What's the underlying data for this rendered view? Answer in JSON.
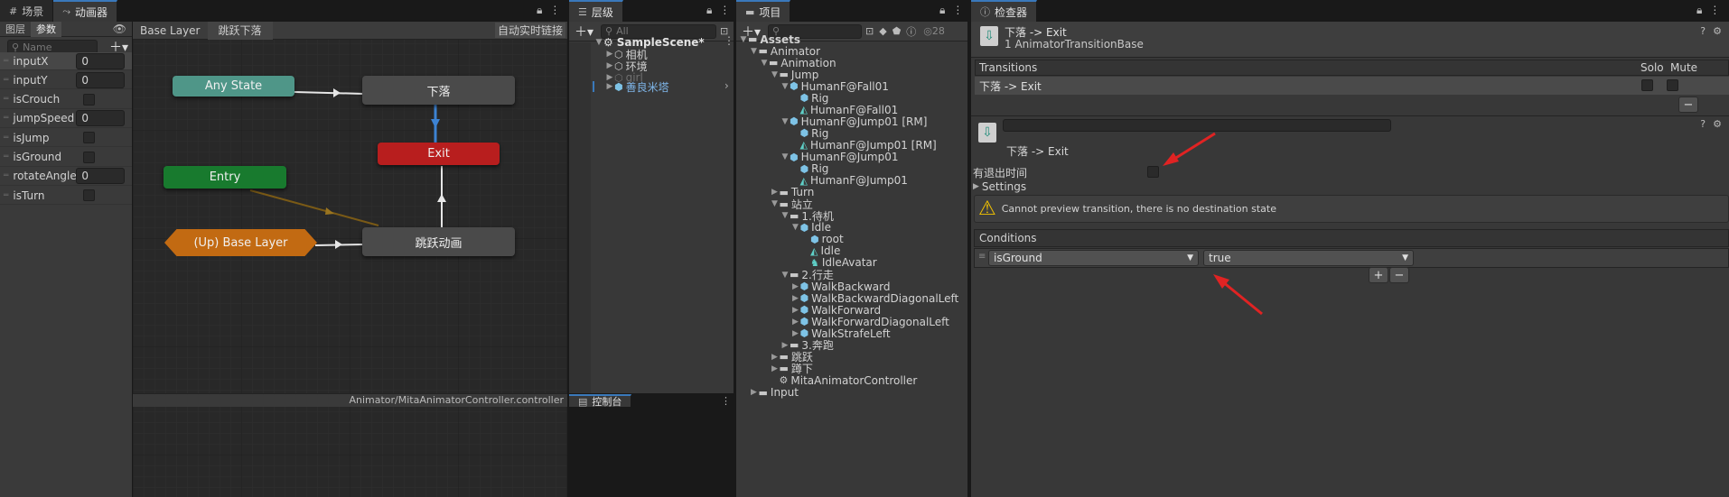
{
  "tabs": {
    "scene": "场景",
    "animator": "动画器",
    "hierarchy": "层级",
    "project": "项目",
    "inspector": "检查器",
    "console": "控制台"
  },
  "animator": {
    "layers_tab": "图层",
    "params_tab": "参数",
    "search_placeholder": "Name",
    "breadcrumb": [
      "Base Layer",
      "跳跃下落"
    ],
    "auto_live_link": "自动实时链接",
    "params": [
      {
        "name": "inputX",
        "type": "float",
        "value": "0"
      },
      {
        "name": "inputY",
        "type": "float",
        "value": "0"
      },
      {
        "name": "isCrouch",
        "type": "bool",
        "value": ""
      },
      {
        "name": "jumpSpeed",
        "type": "float",
        "value": "0"
      },
      {
        "name": "isJump",
        "type": "bool",
        "value": ""
      },
      {
        "name": "isGround",
        "type": "bool",
        "value": ""
      },
      {
        "name": "rotateAngle",
        "type": "float",
        "value": "0"
      },
      {
        "name": "isTurn",
        "type": "bool",
        "value": ""
      }
    ],
    "nodes": {
      "any_state": "Any State",
      "fall": "下落",
      "exit": "Exit",
      "entry": "Entry",
      "up_base": "(Up) Base Layer",
      "jump_anim": "跳跃动画"
    },
    "footer_path": "Animator/MitaAnimatorController.controller"
  },
  "hierarchy": {
    "search_placeholder": "All",
    "scene": "SampleScene*",
    "items": [
      "相机",
      "环境",
      "girl",
      "善良米塔"
    ]
  },
  "project": {
    "count": "28",
    "tree": [
      {
        "label": "Assets",
        "depth": 0,
        "arrow": "down",
        "icon": "folder"
      },
      {
        "label": "Animator",
        "depth": 1,
        "arrow": "down",
        "icon": "folder"
      },
      {
        "label": "Animation",
        "depth": 2,
        "arrow": "down",
        "icon": "folder"
      },
      {
        "label": "Jump",
        "depth": 3,
        "arrow": "down",
        "icon": "folder"
      },
      {
        "label": "HumanF@Fall01",
        "depth": 4,
        "arrow": "down",
        "icon": "cube"
      },
      {
        "label": "Rig",
        "depth": 5,
        "arrow": "",
        "icon": "cube"
      },
      {
        "label": "HumanF@Fall01",
        "depth": 5,
        "arrow": "",
        "icon": "anim"
      },
      {
        "label": "HumanF@Jump01 [RM]",
        "depth": 4,
        "arrow": "down",
        "icon": "cube"
      },
      {
        "label": "Rig",
        "depth": 5,
        "arrow": "",
        "icon": "cube"
      },
      {
        "label": "HumanF@Jump01 [RM]",
        "depth": 5,
        "arrow": "",
        "icon": "anim"
      },
      {
        "label": "HumanF@Jump01",
        "depth": 4,
        "arrow": "down",
        "icon": "cube"
      },
      {
        "label": "Rig",
        "depth": 5,
        "arrow": "",
        "icon": "cube"
      },
      {
        "label": "HumanF@Jump01",
        "depth": 5,
        "arrow": "",
        "icon": "anim"
      },
      {
        "label": "Turn",
        "depth": 3,
        "arrow": "right",
        "icon": "folder"
      },
      {
        "label": "站立",
        "depth": 3,
        "arrow": "down",
        "icon": "folder"
      },
      {
        "label": "1.待机",
        "depth": 4,
        "arrow": "down",
        "icon": "folder"
      },
      {
        "label": "Idle",
        "depth": 5,
        "arrow": "down",
        "icon": "cube"
      },
      {
        "label": "root",
        "depth": 6,
        "arrow": "",
        "icon": "cube"
      },
      {
        "label": "Idle",
        "depth": 6,
        "arrow": "",
        "icon": "anim"
      },
      {
        "label": "IdleAvatar",
        "depth": 6,
        "arrow": "",
        "icon": "avatar"
      },
      {
        "label": "2.行走",
        "depth": 4,
        "arrow": "down",
        "icon": "folder"
      },
      {
        "label": "WalkBackward",
        "depth": 5,
        "arrow": "right",
        "icon": "cube"
      },
      {
        "label": "WalkBackwardDiagonalLeft",
        "depth": 5,
        "arrow": "right",
        "icon": "cube"
      },
      {
        "label": "WalkForward",
        "depth": 5,
        "arrow": "right",
        "icon": "cube"
      },
      {
        "label": "WalkForwardDiagonalLeft",
        "depth": 5,
        "arrow": "right",
        "icon": "cube"
      },
      {
        "label": "WalkStrafeLeft",
        "depth": 5,
        "arrow": "right",
        "icon": "cube"
      },
      {
        "label": "3.奔跑",
        "depth": 4,
        "arrow": "right",
        "icon": "folder"
      },
      {
        "label": "跳跃",
        "depth": 3,
        "arrow": "right",
        "icon": "folder"
      },
      {
        "label": "蹲下",
        "depth": 3,
        "arrow": "right",
        "icon": "folder"
      },
      {
        "label": "MitaAnimatorController",
        "depth": 3,
        "arrow": "",
        "icon": "controller"
      },
      {
        "label": "Input",
        "depth": 1,
        "arrow": "right",
        "icon": "folder"
      }
    ]
  },
  "inspector": {
    "title": "下落 -> Exit",
    "subtitle": "1 AnimatorTransitionBase",
    "transitions_header": "Transitions",
    "solo": "Solo",
    "mute": "Mute",
    "transition_item": "下落 -> Exit",
    "transition_name": "下落 -> Exit",
    "has_exit_time": "有退出时间",
    "settings": "Settings",
    "warning": "Cannot preview transition, there is no destination state",
    "conditions_header": "Conditions",
    "condition_param": "isGround",
    "condition_value": "true"
  },
  "colors": {
    "accent": "#3a79bb",
    "any_state": "#4f9688",
    "exit": "#b81e1e",
    "entry": "#187a2e",
    "up_layer": "#c26a12",
    "arrow_red": "#e02323"
  }
}
